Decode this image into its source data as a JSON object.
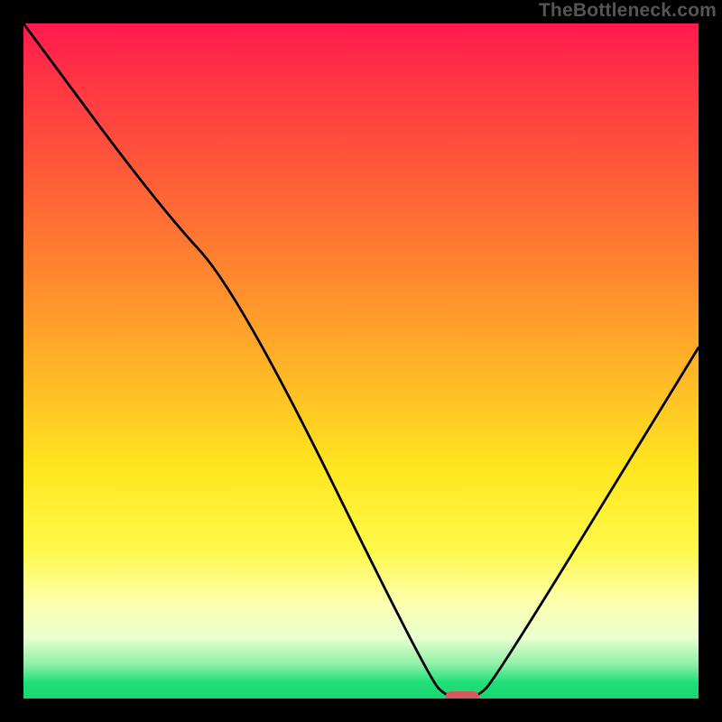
{
  "watermark": "TheBottleneck.com",
  "colors": {
    "background": "#000000",
    "frame": "#000000",
    "curve": "#000000",
    "marker": "#d45a5f",
    "gradient_stops": [
      "#ff1a4d",
      "#ff3344",
      "#ff5a3a",
      "#ff8a2e",
      "#ffb726",
      "#ffe61f",
      "#fff94a",
      "#fdffb0",
      "#e9ffcf",
      "#8cf0a6",
      "#21e07a",
      "#18d66f"
    ]
  },
  "chart_data": {
    "type": "line",
    "title": "",
    "xlabel": "",
    "ylabel": "",
    "xlim": [
      0,
      100
    ],
    "ylim": [
      0,
      100
    ],
    "x": [
      0,
      20,
      32,
      60,
      63,
      67,
      70,
      100
    ],
    "values": [
      100,
      73,
      60,
      3,
      0,
      0,
      3,
      52
    ],
    "minimum_marker": {
      "x": 65,
      "y": 0,
      "width": 5
    },
    "annotations": []
  }
}
